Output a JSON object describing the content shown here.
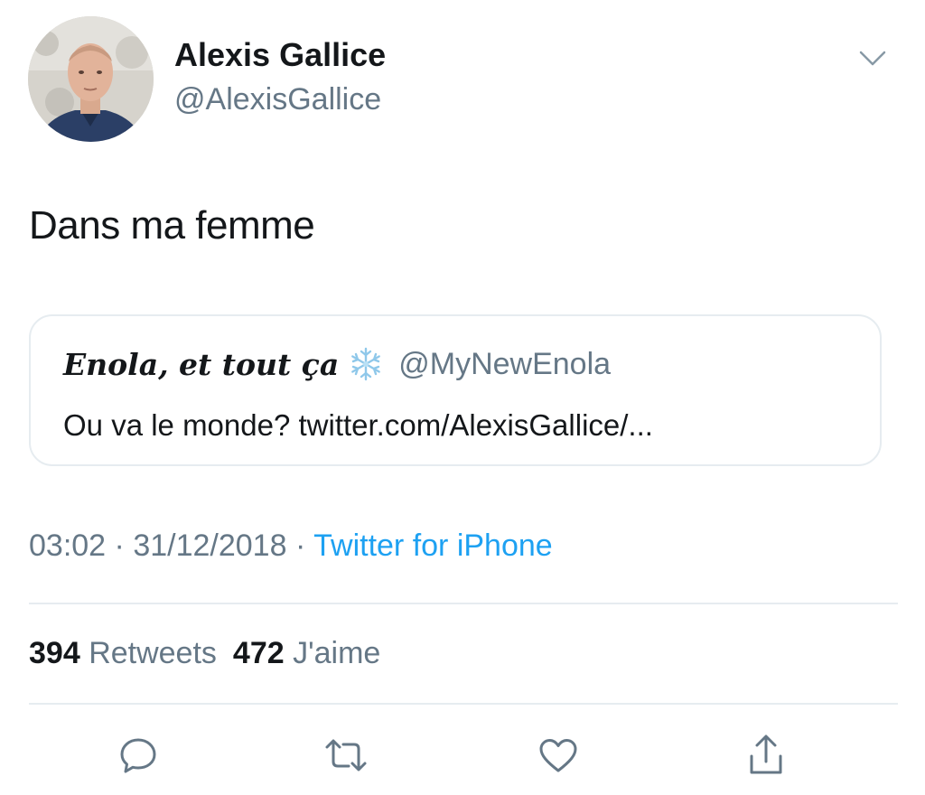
{
  "author": {
    "name": "Alexis Gallice",
    "handle": "@AlexisGallice"
  },
  "tweet": {
    "text": "Dans ma femme"
  },
  "quoted_tweet": {
    "name": "Enola, et tout ça",
    "emoji_icon": "snowflake-icon",
    "handle": "@MyNewEnola",
    "text": "Ou va le monde? twitter.com/AlexisGallice/..."
  },
  "meta": {
    "time": "03:02",
    "separator": "·",
    "date": "31/12/2018",
    "source": "Twitter for iPhone"
  },
  "stats": {
    "retweets_count": "394",
    "retweets_label": "Retweets",
    "likes_count": "472",
    "likes_label": "J'aime"
  },
  "actions": [
    "reply-icon",
    "retweet-icon",
    "like-icon",
    "share-icon"
  ],
  "colors": {
    "text": "#14171a",
    "secondary": "#657786",
    "link": "#1da1f2",
    "border": "#e6ecf0"
  }
}
